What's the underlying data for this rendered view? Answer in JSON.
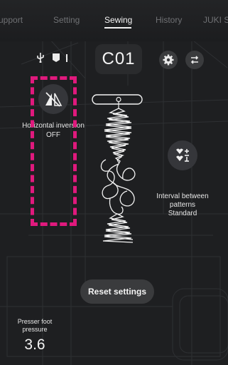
{
  "tabs": [
    {
      "label": "Support",
      "display": "upport"
    },
    {
      "label": "Setting"
    },
    {
      "label": "Sewing"
    },
    {
      "label": "History"
    },
    {
      "label": "JUKI S"
    }
  ],
  "toolbar": {
    "pattern_code": "C01",
    "usb_icon": "usb-icon",
    "bobbin_icon": "bobbin-icon",
    "settings_icon": "gear-icon",
    "swap_icon": "swap-icon"
  },
  "horizontal_inversion": {
    "label": "Horizontal inversion",
    "value": "OFF",
    "icon": "mirror-triangle-icon"
  },
  "interval": {
    "label_line1": "Interval between",
    "label_line2": "patterns",
    "value": "Standard",
    "icon": "interval-icon"
  },
  "reset": {
    "label": "Reset settings"
  },
  "presser_foot": {
    "label_line1": "Presser foot",
    "label_line2": "pressure",
    "value": "3.6"
  },
  "colors": {
    "background": "#1e1f21",
    "highlight": "#e0197d",
    "button": "#3a3b3d"
  }
}
